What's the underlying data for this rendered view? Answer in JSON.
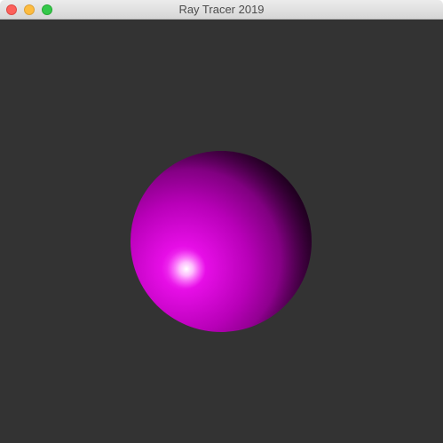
{
  "window": {
    "title": "Ray Tracer 2019",
    "controls": {
      "close": "close-icon",
      "minimize": "minimize-icon",
      "zoom": "zoom-icon"
    }
  },
  "scene": {
    "background_color": "#333333",
    "sphere": {
      "base_color": "#cc00cc",
      "highlight_color": "#ffffff",
      "shadow_color": "#000000"
    }
  }
}
